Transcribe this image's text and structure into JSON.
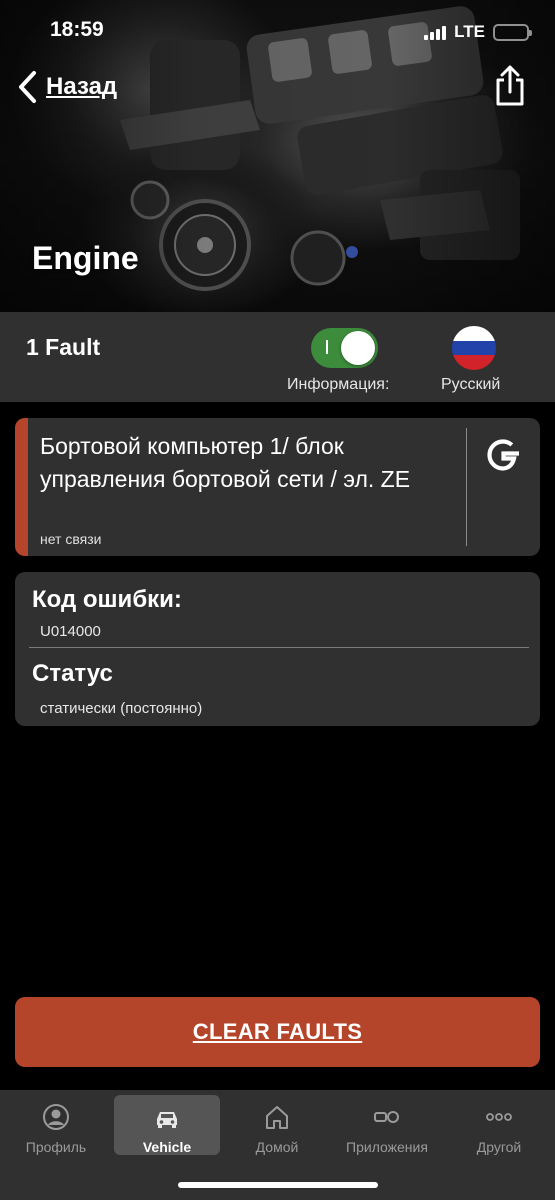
{
  "status_bar": {
    "time": "18:59",
    "network": "LTE",
    "battery_level": 1.0
  },
  "nav": {
    "back_label": "Назад",
    "share_icon": "share-icon"
  },
  "hero": {
    "title": "Engine"
  },
  "fault_bar": {
    "fault_count": "1 Fault",
    "info_toggle_on": true,
    "info_label": "Информация:",
    "language_label": "Русский",
    "flag_colors": [
      "#ffffff",
      "#2244aa",
      "#d2232a"
    ]
  },
  "module": {
    "title": "Бортовой компьютер 1/ блок управления бортовой сети / эл. ZE",
    "subtitle": "нет связи",
    "accent_color": "#b5452a",
    "google_icon": "google-icon"
  },
  "details": {
    "code_label": "Код ошибки:",
    "code_value": "U014000",
    "status_label": "Статус",
    "status_value": "статически (постоянно)"
  },
  "actions": {
    "clear_label": "CLEAR FAULTS"
  },
  "tabs": [
    {
      "label": "Профиль",
      "icon": "profile-icon",
      "active": false
    },
    {
      "label": "Vehicle",
      "icon": "car-icon",
      "active": true
    },
    {
      "label": "Домой",
      "icon": "home-icon",
      "active": false
    },
    {
      "label": "Приложения",
      "icon": "apps-icon",
      "active": false
    },
    {
      "label": "Другой",
      "icon": "more-icon",
      "active": false
    }
  ]
}
